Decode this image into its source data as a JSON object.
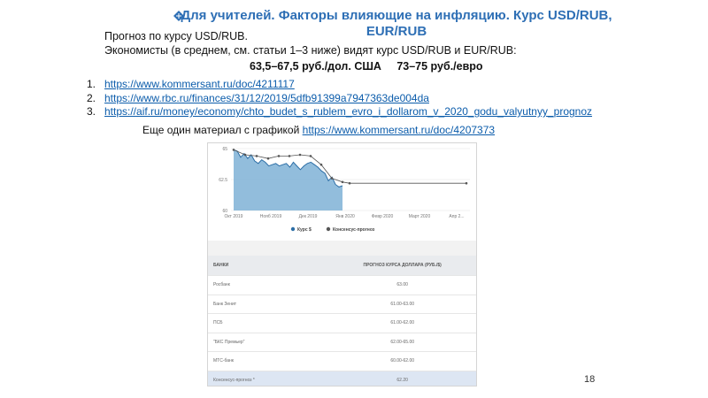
{
  "header": {
    "title_line1": "Для учителей. Факторы влияющие на инфляцию. Курс USD/RUB,",
    "title_line2": "EUR/RUB"
  },
  "intro": {
    "line1": "Прогноз по курсу USD/RUB.",
    "line2": "Экономисты (в среднем, см. статьи 1–3 ниже) видят курс USD/RUB и EUR/RUB:"
  },
  "forecast": {
    "usd": "63,5–67,5 руб./дол. США",
    "eur": "73–75 руб./евро"
  },
  "links": [
    {
      "num": "1.",
      "url": "https://www.kommersant.ru/doc/4211117"
    },
    {
      "num": "2.",
      "url": "https://www.rbc.ru/finances/31/12/2019/5dfb91399a7947363de004da"
    },
    {
      "num": "3.",
      "url": "https://aif.ru/money/economy/chto_budet_s_rublem_evro_i_dollarom_v_2020_godu_valyutnyy_prognoz"
    }
  ],
  "extra": {
    "text": "Еще один материал с графикой ",
    "url": "https://www.kommersant.ru/doc/4207373"
  },
  "chart_data": {
    "type": "area",
    "y_ticks": [
      "65",
      "62.5",
      "60"
    ],
    "x_ticks": [
      "Окт 2019",
      "Нояб 2019",
      "Дек 2019",
      "Янв 2020",
      "Февр 2020",
      "Март 2020",
      "Апр 2..."
    ],
    "ylim": [
      60,
      65
    ],
    "series": [
      {
        "name": "Курс $",
        "color": "#2c6ea6",
        "values": [
          64.9,
          64.8,
          64.3,
          64.6,
          64.2,
          64.5,
          64.0,
          63.8,
          64.1,
          63.9,
          63.6,
          63.7,
          63.8,
          63.6,
          63.7,
          63.8,
          63.5,
          63.9,
          63.6,
          63.3,
          63.6,
          63.8,
          63.9,
          63.7,
          63.5,
          63.2,
          63.0,
          62.4,
          62.7,
          62.1,
          61.9,
          62.0
        ]
      },
      {
        "name": "Консенсус-прогноз",
        "color": "#555555",
        "values": [
          64.9,
          64.5,
          64.4,
          64.2,
          64.4,
          64.4,
          64.5,
          64.4,
          63.7,
          62.6,
          62.3,
          62.2,
          62.2
        ]
      }
    ],
    "grid": true,
    "legend": "bottom"
  },
  "table": {
    "headers": [
      "БАНКИ",
      "ПРОГНОЗ КУРСА ДОЛЛАРА (РУБ./$)"
    ],
    "rows": [
      [
        "Росбанк",
        "63.00"
      ],
      [
        "Банк Зенит",
        "61.00-63.00"
      ],
      [
        "ПСБ",
        "61.00-62.00"
      ],
      [
        "\"БКС Премьер\"",
        "62.00-65.00"
      ],
      [
        "МТС-банк",
        "60.00-62.00"
      ],
      [
        "Консенсус-прогноз *",
        "62.20"
      ]
    ]
  },
  "page": {
    "number": "18"
  }
}
